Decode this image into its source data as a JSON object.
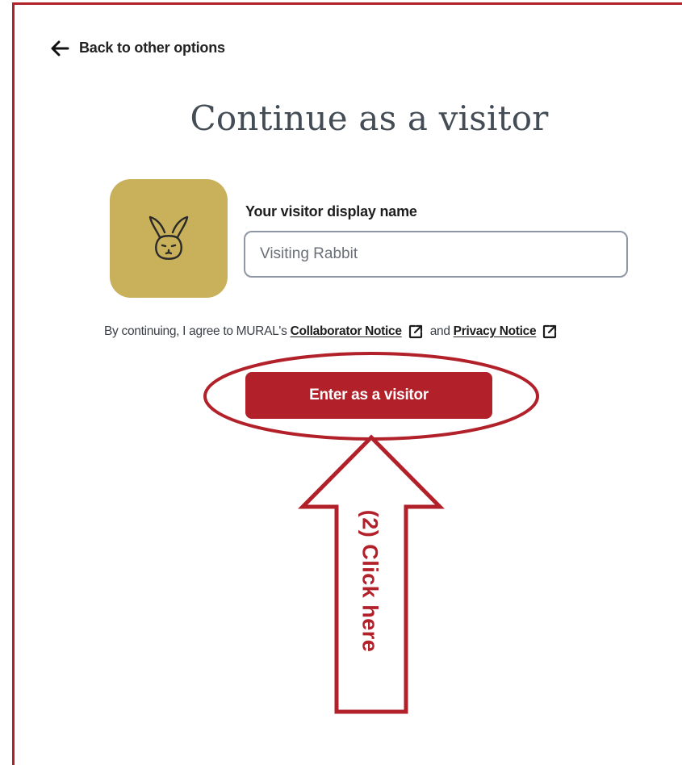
{
  "nav": {
    "back_label": "Back to other options",
    "back_icon": "arrow-left-icon"
  },
  "page": {
    "title": "Continue as a visitor"
  },
  "avatar": {
    "icon": "rabbit-icon",
    "background_color": "#c9b05b"
  },
  "form": {
    "display_name_label": "Your visitor display name",
    "display_name_placeholder": "Visiting Rabbit",
    "display_name_value": ""
  },
  "notice": {
    "prefix": "By continuing, I agree to MURAL's",
    "collaborator_link": "Collaborator Notice",
    "conjunction": "and",
    "privacy_link": "Privacy Notice",
    "link_icon": "external-link-icon"
  },
  "actions": {
    "enter_label": "Enter as a visitor"
  },
  "annotation": {
    "callout_text": "(2) Click here",
    "color": "#b22029"
  },
  "colors": {
    "brand_red": "#b22029",
    "heading_text": "#444c55"
  }
}
